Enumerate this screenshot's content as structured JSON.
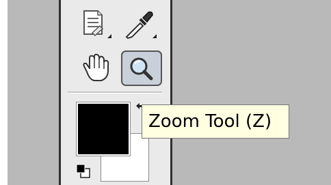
{
  "tooltip": {
    "text": "Zoom Tool (Z)"
  },
  "tools": [
    {
      "icon": "notes-icon",
      "active": false
    },
    {
      "icon": "eyedropper-icon",
      "active": false
    },
    {
      "icon": "hand-icon",
      "active": false
    },
    {
      "icon": "zoom-icon",
      "active": true
    }
  ],
  "colors": {
    "foreground": "#000000",
    "background": "#ffffff",
    "canvas": "#b9b9b9",
    "toolbox": "#eaeaea",
    "tooltip_bg": "#ffffe1"
  }
}
